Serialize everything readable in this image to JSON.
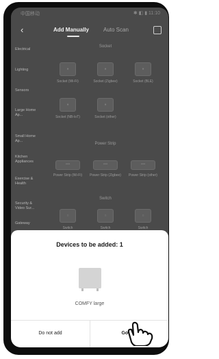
{
  "statusbar": {
    "left": "中国移动",
    "right": "✱ ◧ ▮ 11:10"
  },
  "header": {
    "back_icon": "‹",
    "tab_add": "Add Manually",
    "tab_auto": "Auto Scan"
  },
  "sidebar": {
    "items": [
      "Electrical",
      "Lighting",
      "Sensors",
      "Large Home Ap...",
      "Small Home Ap...",
      "Kitchen Appliances",
      "Exercise & Health",
      "Security & Video Sur...",
      "Gateway"
    ]
  },
  "sections": {
    "socket": "Socket",
    "power_strip": "Power Strip",
    "switch": "Switch"
  },
  "devices": {
    "socket": [
      "Socket (Wi-Fi)",
      "Socket (Zigbee)",
      "Socket (BLE)",
      "Socket (NB-IoT)",
      "Socket (other)"
    ],
    "power_strip": [
      "Power Strip (Wi-Fi)",
      "Power Strip (Zigbee)",
      "Power Strip (other)"
    ],
    "switch": [
      "Switch",
      "Switch",
      "Switch"
    ]
  },
  "sheet": {
    "title": "Devices to be added: 1",
    "device_name": "COMFY large",
    "button_left": "Do not add",
    "button_right": "Go to a"
  }
}
